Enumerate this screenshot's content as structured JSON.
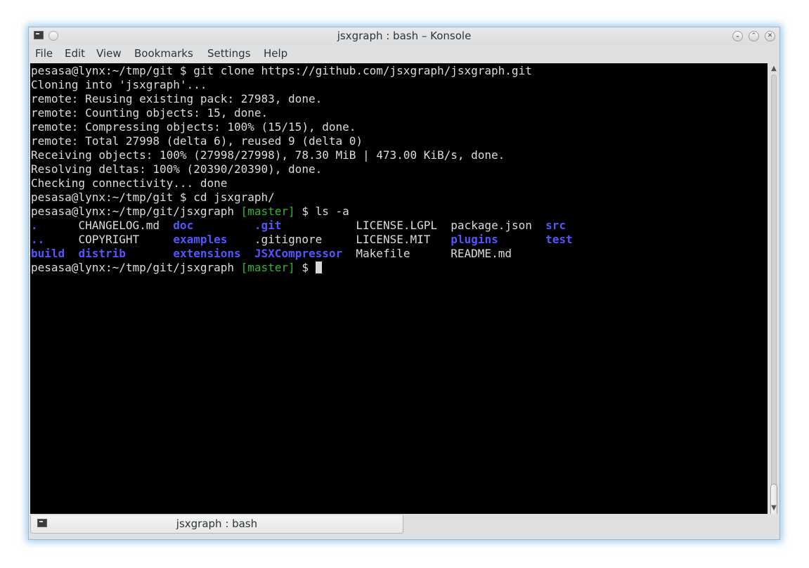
{
  "window": {
    "title": "jsxgraph : bash – Konsole"
  },
  "titlebar_buttons": {
    "minimize_icon": "chevron-down-icon",
    "maximize_icon": "chevron-up-icon",
    "close_icon": "close-icon",
    "minimize_glyph": "⌄",
    "maximize_glyph": "⌃",
    "close_glyph": "✕"
  },
  "menu": {
    "items": [
      "File",
      "Edit",
      "View",
      "Bookmarks",
      "Settings",
      "Help"
    ]
  },
  "terminal": {
    "colors": {
      "background": "#000000",
      "foreground": "#dcdcdc",
      "git_branch": "#33b533",
      "directory": "#5555ff"
    },
    "lines": [
      "pesasa@lynx:~/tmp/git $ git clone https://github.com/jsxgraph/jsxgraph.git",
      "Cloning into 'jsxgraph'...",
      "remote: Reusing existing pack: 27983, done.",
      "remote: Counting objects: 15, done.",
      "remote: Compressing objects: 100% (15/15), done.",
      "remote: Total 27998 (delta 6), reused 9 (delta 0)",
      "Receiving objects: 100% (27998/27998), 78.30 MiB | 473.00 KiB/s, done.",
      "Resolving deltas: 100% (20390/20390), done.",
      "Checking connectivity... done",
      "pesasa@lynx:~/tmp/git $ cd jsxgraph/"
    ],
    "prompt_ls": {
      "prefix": "pesasa@lynx:~/tmp/git/jsxgraph ",
      "branch": "[master]",
      "command": " $ ls -a"
    },
    "ls_rows": [
      [
        {
          "text": ".",
          "dir": true
        },
        {
          "text": "CHANGELOG.md",
          "dir": false
        },
        {
          "text": "doc",
          "dir": true
        },
        {
          "text": ".git",
          "dir": true
        },
        {
          "text": "LICENSE.LGPL",
          "dir": false
        },
        {
          "text": "package.json",
          "dir": false
        },
        {
          "text": "src",
          "dir": true
        }
      ],
      [
        {
          "text": "..",
          "dir": true
        },
        {
          "text": "COPYRIGHT",
          "dir": false
        },
        {
          "text": "examples",
          "dir": true
        },
        {
          "text": ".gitignore",
          "dir": false
        },
        {
          "text": "LICENSE.MIT",
          "dir": false
        },
        {
          "text": "plugins",
          "dir": true
        },
        {
          "text": "test",
          "dir": true
        }
      ],
      [
        {
          "text": "build",
          "dir": true
        },
        {
          "text": "distrib",
          "dir": true
        },
        {
          "text": "extensions",
          "dir": true
        },
        {
          "text": "JSXCompressor",
          "dir": true
        },
        {
          "text": "Makefile",
          "dir": false
        },
        {
          "text": "README.md",
          "dir": false
        },
        {
          "text": "",
          "dir": false
        }
      ]
    ],
    "prompt_final": {
      "prefix": "pesasa@lynx:~/tmp/git/jsxgraph ",
      "branch": "[master]",
      "command": " $ "
    }
  },
  "tabs": [
    {
      "label": "jsxgraph : bash",
      "icon": "terminal-icon"
    }
  ]
}
